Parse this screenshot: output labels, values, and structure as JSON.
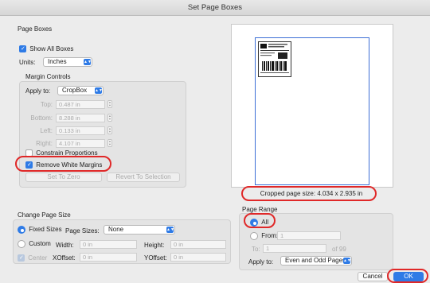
{
  "window": {
    "title": "Set Page Boxes"
  },
  "page_boxes": {
    "label": "Page Boxes",
    "show_all_boxes": {
      "label": "Show All Boxes",
      "checked": true
    },
    "units": {
      "label": "Units:",
      "value": "Inches"
    }
  },
  "margin_controls": {
    "label": "Margin Controls",
    "apply_to": {
      "label": "Apply to:",
      "value": "CropBox"
    },
    "top": {
      "label": "Top:",
      "value": "0.487 in"
    },
    "bottom": {
      "label": "Bottom:",
      "value": "8.288 in"
    },
    "left": {
      "label": "Left:",
      "value": "0.133 in"
    },
    "right": {
      "label": "Right:",
      "value": "4.107 in"
    },
    "constrain": {
      "label": "Constrain Proportions",
      "checked": false
    },
    "remove_white_margins": {
      "label": "Remove White Margins",
      "checked": true
    },
    "set_to_zero": "Set To Zero",
    "revert_to_selection": "Revert To Selection"
  },
  "preview": {
    "cropped_size": "Cropped page size: 4.034 x 2.935 in"
  },
  "change_page_size": {
    "label": "Change Page Size",
    "fixed_sizes": {
      "label": "Fixed Sizes",
      "selected": true
    },
    "page_sizes": {
      "label": "Page Sizes:",
      "value": "None"
    },
    "custom": {
      "label": "Custom",
      "selected": false
    },
    "width": {
      "label": "Width:",
      "value": "0 in"
    },
    "height": {
      "label": "Height:",
      "value": "0 in"
    },
    "center": {
      "label": "Center",
      "checked": true
    },
    "xoffset": {
      "label": "XOffset:",
      "value": "0 in"
    },
    "yoffset": {
      "label": "YOffset:",
      "value": "0 in"
    }
  },
  "page_range": {
    "label": "Page Range",
    "all": {
      "label": "All",
      "selected": true
    },
    "from": {
      "label": "From:",
      "value": "1"
    },
    "to": {
      "label": "To:",
      "value": "1"
    },
    "of": "of 99",
    "apply_to": {
      "label": "Apply to:",
      "value": "Even and Odd Pages"
    }
  },
  "buttons": {
    "cancel": "Cancel",
    "ok": "OK"
  },
  "colors": {
    "accent": "#2f7be6",
    "annotation": "#e02828",
    "crop_border": "#3d6fd6"
  }
}
